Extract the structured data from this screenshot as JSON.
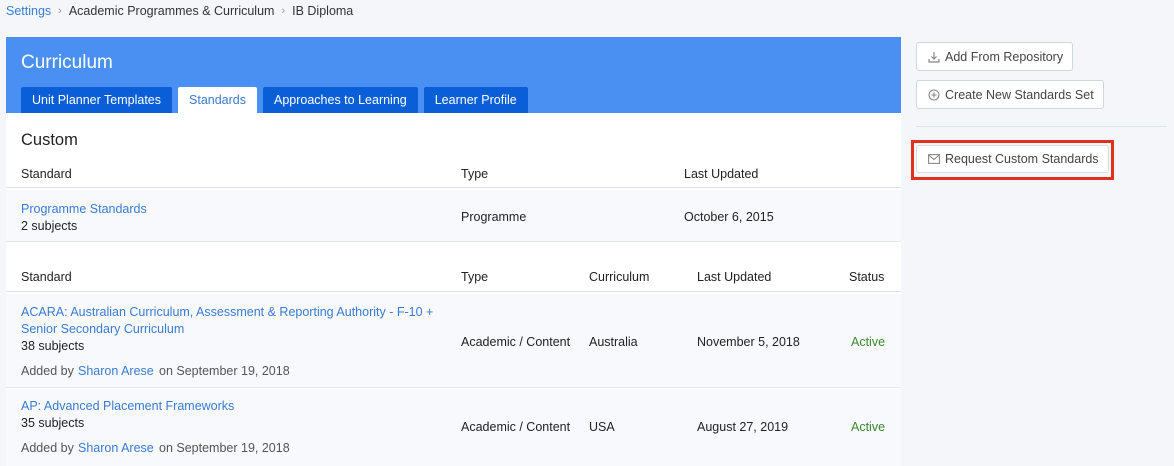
{
  "breadcrumb": {
    "items": [
      "Settings",
      "Academic Programmes & Curriculum",
      "IB Diploma"
    ],
    "separator": "›"
  },
  "panel": {
    "title": "Curriculum",
    "tabs": [
      {
        "label": "Unit Planner Templates",
        "active": false
      },
      {
        "label": "Standards",
        "active": true
      },
      {
        "label": "Approaches to Learning",
        "active": false
      },
      {
        "label": "Learner Profile",
        "active": false
      }
    ]
  },
  "custom": {
    "title": "Custom",
    "headers": {
      "standard": "Standard",
      "type": "Type",
      "last_updated": "Last Updated"
    },
    "rows": [
      {
        "name": "Programme Standards",
        "subjects": "2 subjects",
        "type": "Programme",
        "last_updated": "October 6, 2015"
      }
    ]
  },
  "standards": {
    "headers": {
      "standard": "Standard",
      "type": "Type",
      "curriculum": "Curriculum",
      "last_updated": "Last Updated",
      "status": "Status"
    },
    "rows": [
      {
        "name_line1": "ACARA: Australian Curriculum, Assessment & Reporting Authority - F-10 +",
        "name_line2": "Senior Secondary Curriculum",
        "subjects": "38 subjects",
        "added_prefix": "Added by",
        "added_by": "Sharon Arese",
        "added_suffix": "on September 19, 2018",
        "type": "Academic / Content",
        "curriculum": "Australia",
        "last_updated": "November 5, 2018",
        "status": "Active"
      },
      {
        "name_line1": "AP: Advanced Placement Frameworks",
        "subjects": "35 subjects",
        "added_prefix": "Added by",
        "added_by": "Sharon Arese",
        "added_suffix": "on September 19, 2018",
        "type": "Academic / Content",
        "curriculum": "USA",
        "last_updated": "August 27, 2019",
        "status": "Active"
      }
    ]
  },
  "sidebar": {
    "add_from_repository": "Add From Repository",
    "create_new_standards_set": "Create New Standards Set",
    "request_custom_standards": "Request Custom Standards"
  },
  "colors": {
    "header_blue": "#4a90f2",
    "tab_blue": "#0a5fd8",
    "link_blue": "#3a7bd5",
    "status_green": "#3a8a2a",
    "highlight_red": "#e0301e"
  }
}
